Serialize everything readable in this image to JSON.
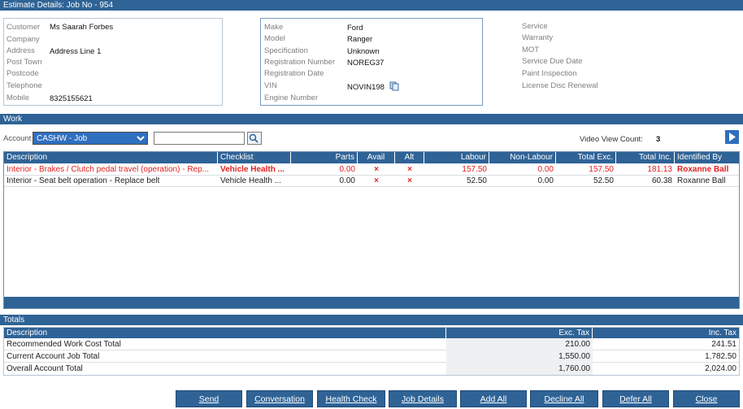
{
  "estimate": {
    "title": "Estimate Details: Job No - 954"
  },
  "customer": {
    "labels": [
      "Customer",
      "Company",
      "Address",
      "Post Town",
      "Postcode",
      "Telephone",
      "Mobile"
    ],
    "customer": "Ms Saarah Forbes",
    "address": "Address Line 1",
    "mobile": "8325155621"
  },
  "vehicle": {
    "labels": [
      "Make",
      "Model",
      "Specification",
      "Registration Number",
      "Registration Date",
      "VIN",
      "Engine Number"
    ],
    "make": "Ford",
    "model": "Ranger",
    "specification": "Unknown",
    "registration_number": "NOREG37",
    "vin": "NOVIN198"
  },
  "service": {
    "labels": [
      "Service",
      "Warranty",
      "MOT",
      "Service Due Date",
      "Paint Inspection",
      "License Disc Renewal"
    ]
  },
  "work": {
    "title": "Work",
    "account_label": "Account",
    "account_value": "CASHW - Job",
    "video_label": "Video View Count:",
    "video_count": "3",
    "columns": [
      "Description",
      "Checklist",
      "Parts",
      "Avail",
      "Alt",
      "Labour",
      "Non-Labour",
      "Total Exc.",
      "Total Inc.",
      "Identified By"
    ],
    "rows": [
      {
        "description": "Interior - Brakes / Clutch pedal travel (operation) - Rep...",
        "checklist": "Vehicle Health ...",
        "parts": "0.00",
        "avail": "×",
        "alt": "×",
        "labour": "157.50",
        "non_labour": "0.00",
        "total_exc": "157.50",
        "total_inc": "181.13",
        "identified_by": "Roxanne Ball",
        "highlight": true
      },
      {
        "description": "Interior - Seat belt operation - Replace belt",
        "checklist": "Vehicle Health ...",
        "parts": "0.00",
        "avail": "×",
        "alt": "×",
        "labour": "52.50",
        "non_labour": "0.00",
        "total_exc": "52.50",
        "total_inc": "60.38",
        "identified_by": "Roxanne Ball",
        "highlight": false
      }
    ]
  },
  "totals": {
    "title": "Totals",
    "columns": [
      "Description",
      "Exc. Tax",
      "Inc. Tax"
    ],
    "rows": [
      {
        "description": "Recommended Work Cost Total",
        "exc": "210.00",
        "inc": "241.51"
      },
      {
        "description": "Current Account Job Total",
        "exc": "1,550.00",
        "inc": "1,782.50"
      },
      {
        "description": "Overall Account Total",
        "exc": "1,760.00",
        "inc": "2,024.00"
      }
    ]
  },
  "buttons": [
    "Send",
    "Conversation",
    "Health Check",
    "Job Details",
    "Add All",
    "Decline All",
    "Defer All",
    "Close"
  ],
  "colors": {
    "header": "#2f6396",
    "highlight_text": "#e02020",
    "alt_mark": "#e02020"
  }
}
